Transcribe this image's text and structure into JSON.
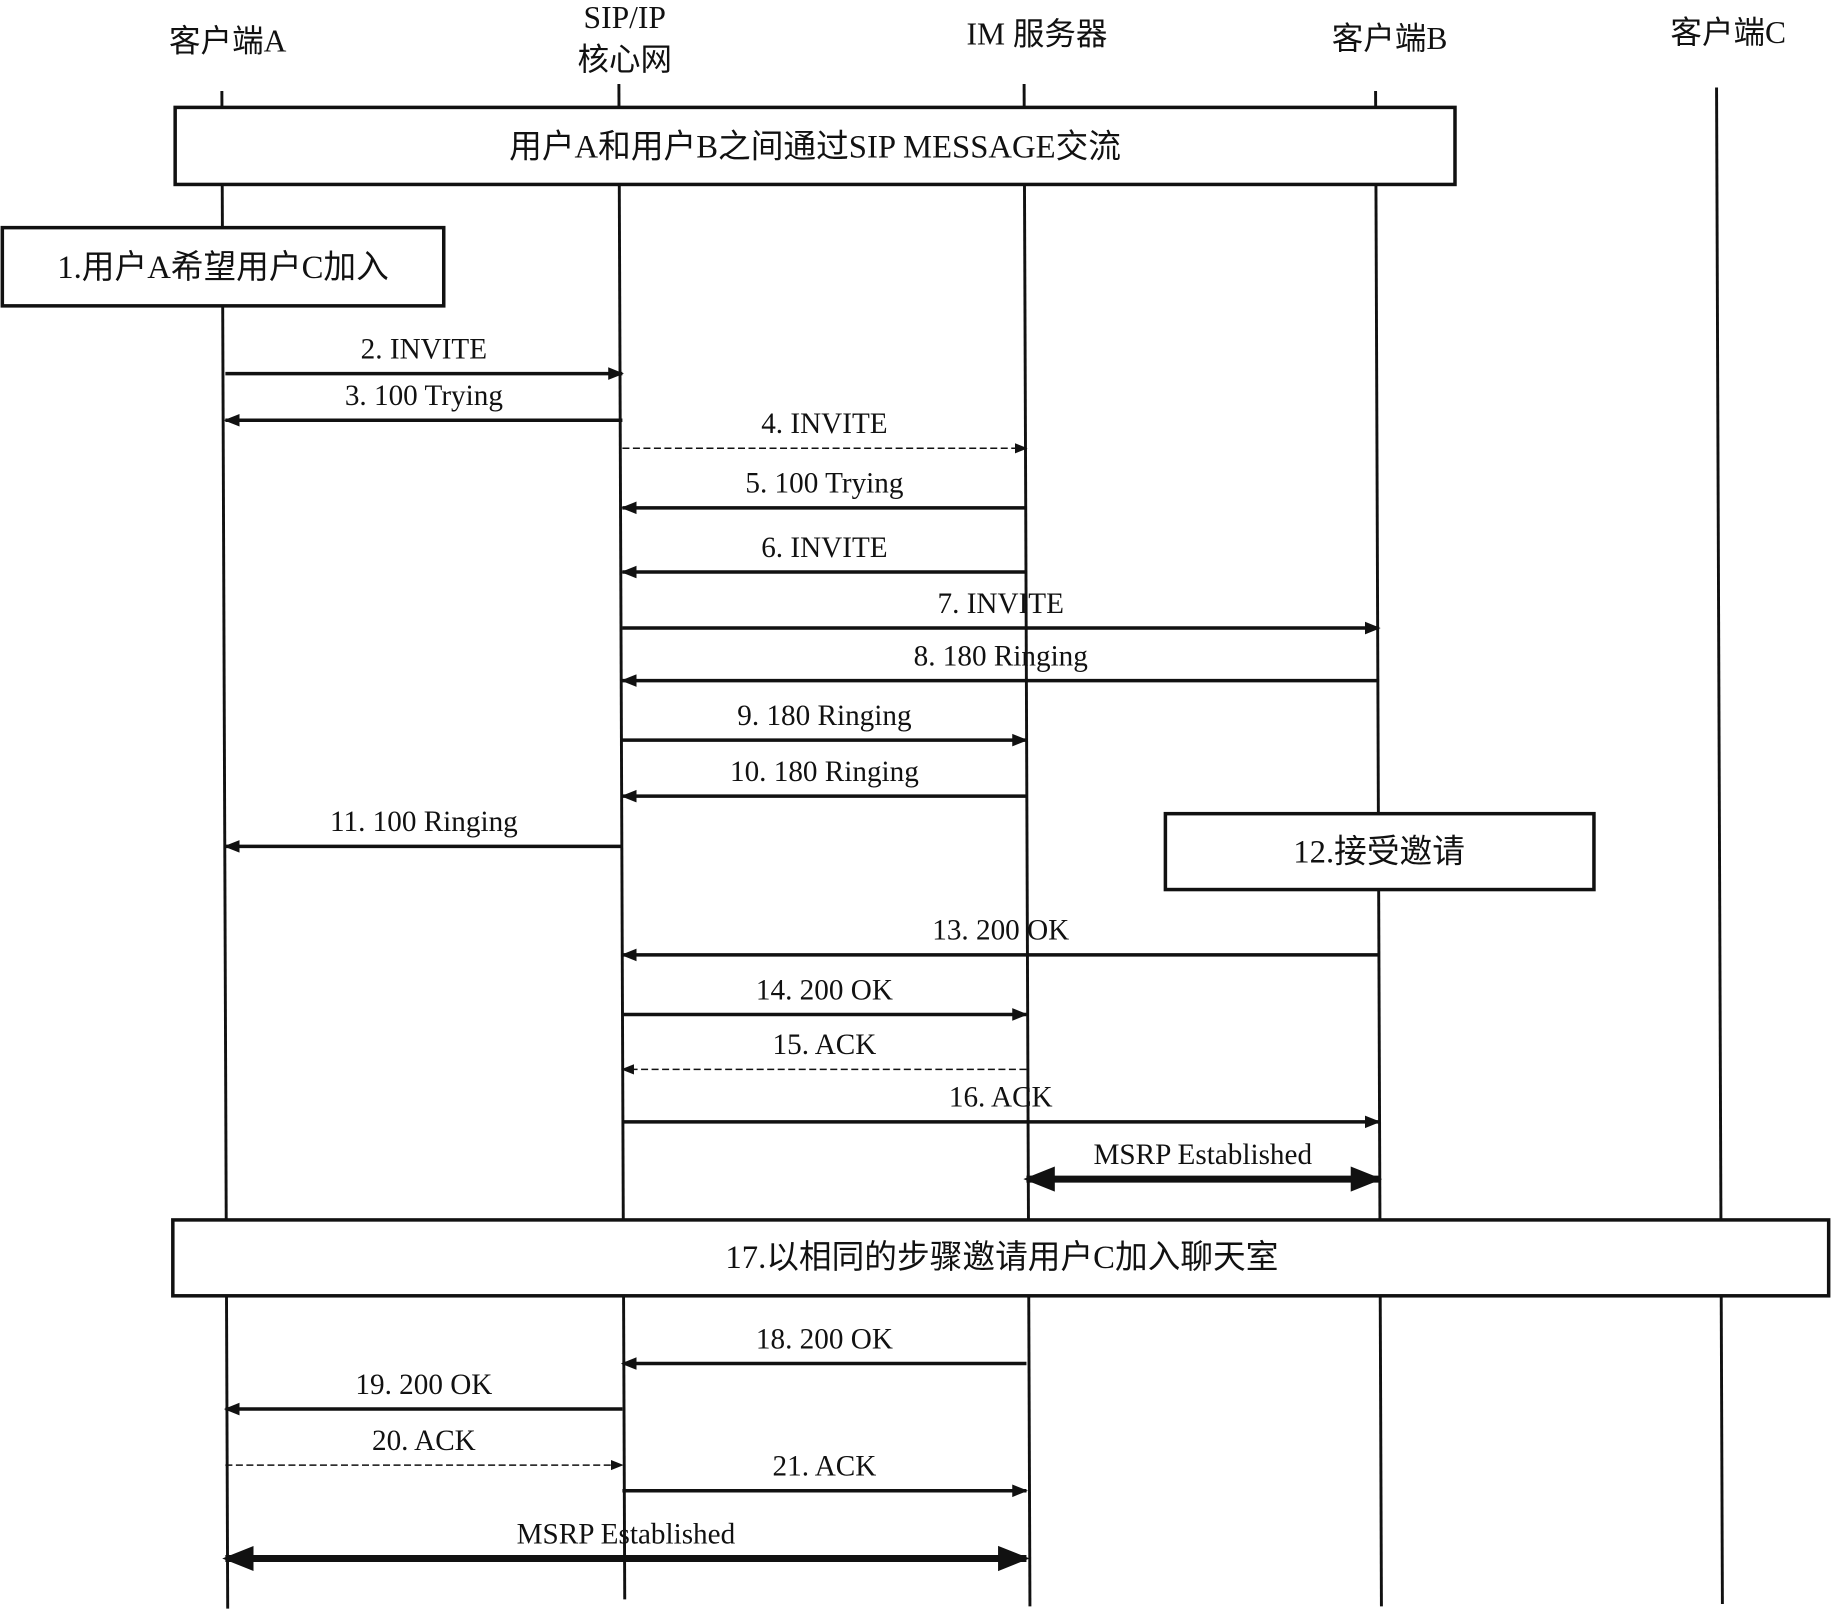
{
  "diagram": {
    "type": "sequence-diagram",
    "participants": [
      {
        "id": "A",
        "label": [
          "客户端A"
        ]
      },
      {
        "id": "SIP",
        "label": [
          "SIP/IP",
          "核心网"
        ]
      },
      {
        "id": "IM",
        "label": [
          "IM 服务器"
        ]
      },
      {
        "id": "B",
        "label": [
          "客户端B"
        ]
      },
      {
        "id": "C",
        "label": [
          "客户端C"
        ]
      }
    ],
    "notes": [
      {
        "id": "n0",
        "text": "用户A和用户B之间通过SIP MESSAGE交流",
        "span": [
          "A",
          "B"
        ]
      },
      {
        "id": "n1",
        "text": "1.用户A希望用户C加入",
        "over": "A"
      },
      {
        "id": "n12",
        "text": "12.接受邀请",
        "over": "B"
      },
      {
        "id": "n17",
        "text": "17.以相同的步骤邀请用户C加入聊天室",
        "span": [
          "A",
          "C"
        ]
      }
    ],
    "messages": [
      {
        "label": "2. INVITE",
        "from": "A",
        "to": "SIP",
        "style": "solid"
      },
      {
        "label": "3. 100 Trying",
        "from": "SIP",
        "to": "A",
        "style": "solid"
      },
      {
        "label": "4. INVITE",
        "from": "SIP",
        "to": "IM",
        "style": "dashed"
      },
      {
        "label": "5. 100 Trying",
        "from": "IM",
        "to": "SIP",
        "style": "solid"
      },
      {
        "label": "6. INVITE",
        "from": "IM",
        "to": "SIP",
        "style": "solid"
      },
      {
        "label": "7. INVITE",
        "from": "SIP",
        "to": "B",
        "style": "solid"
      },
      {
        "label": "8. 180 Ringing",
        "from": "B",
        "to": "SIP",
        "style": "solid"
      },
      {
        "label": "9. 180 Ringing",
        "from": "SIP",
        "to": "IM",
        "style": "solid"
      },
      {
        "label": "10. 180 Ringing",
        "from": "IM",
        "to": "SIP",
        "style": "solid"
      },
      {
        "label": "11. 100 Ringing",
        "from": "SIP",
        "to": "A",
        "style": "solid"
      },
      {
        "label": "13. 200 OK",
        "from": "B",
        "to": "SIP",
        "style": "solid"
      },
      {
        "label": "14. 200 OK",
        "from": "SIP",
        "to": "IM",
        "style": "solid"
      },
      {
        "label": "15. ACK",
        "from": "IM",
        "to": "SIP",
        "style": "dashed"
      },
      {
        "label": "16. ACK",
        "from": "SIP",
        "to": "B",
        "style": "solid"
      },
      {
        "label": "MSRP Established",
        "from": "IM",
        "to": "B",
        "style": "double"
      },
      {
        "label": "18. 200 OK",
        "from": "IM",
        "to": "SIP",
        "style": "solid"
      },
      {
        "label": "19. 200 OK",
        "from": "SIP",
        "to": "A",
        "style": "solid"
      },
      {
        "label": "20. ACK",
        "from": "A",
        "to": "SIP",
        "style": "dashed"
      },
      {
        "label": "21. ACK",
        "from": "SIP",
        "to": "IM",
        "style": "solid"
      },
      {
        "label": "MSRP Established",
        "from": "A",
        "to": "IM",
        "style": "double"
      }
    ]
  }
}
